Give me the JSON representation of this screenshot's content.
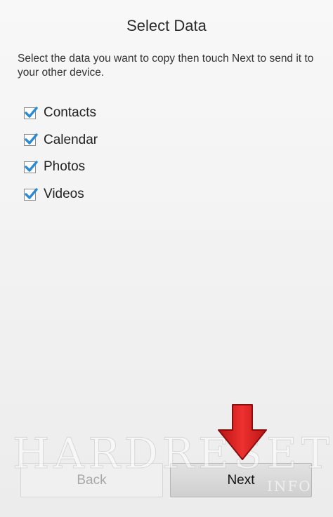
{
  "header": {
    "title": "Select Data"
  },
  "instructions": "Select the data you want to copy then touch Next to send it to your other device.",
  "items": [
    {
      "label": "Contacts",
      "checked": true
    },
    {
      "label": "Calendar",
      "checked": true
    },
    {
      "label": "Photos",
      "checked": true
    },
    {
      "label": "Videos",
      "checked": true
    }
  ],
  "buttons": {
    "back_label": "Back",
    "next_label": "Next"
  },
  "watermark": {
    "main": "HARDRESET",
    "sub": "INFO"
  },
  "colors": {
    "checkmark": "#2a8ad4",
    "arrow": "#d61f1f"
  }
}
